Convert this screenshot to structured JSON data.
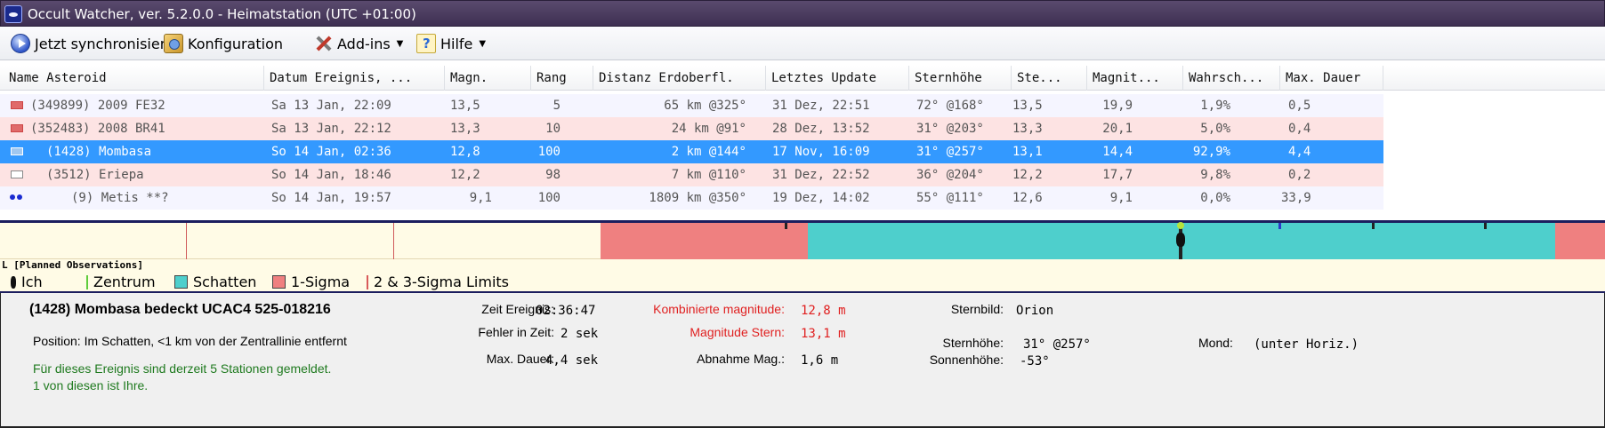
{
  "window": {
    "title": "Occult Watcher, ver. 5.2.0.0 - Heimatstation (UTC +01:00)"
  },
  "toolbar": {
    "sync": "Jetzt synchronisieren",
    "config": "Konfiguration",
    "addins": "Add-ins",
    "help": "Hilfe"
  },
  "table": {
    "headers": [
      "Name Asteroid",
      "Datum Ereignis, ...",
      "Magn.",
      "Rang",
      "Distanz Erdoberfl.",
      "Letztes Update",
      "Sternhöhe",
      "Ste...",
      "Magnit...",
      "Wahrsch...",
      "Max. Dauer"
    ],
    "rows": [
      {
        "name": "(349899) 2009 FE32",
        "date": "Sa 13 Jan, 22:09",
        "magn": "13,5",
        "rang": "5",
        "dist": "65 km @325°",
        "update": "31 Dez, 22:51",
        "alt": "72° @168°",
        "ste": "13,5",
        "magnit": "19,9",
        "prob": "1,9%",
        "dur": "0,5"
      },
      {
        "name": "(352483) 2008 BR41",
        "date": "Sa 13 Jan, 22:12",
        "magn": "13,3",
        "rang": "10",
        "dist": "24 km @91°",
        "update": "28 Dez, 13:52",
        "alt": "31° @203°",
        "ste": "13,3",
        "magnit": "20,1",
        "prob": "5,0%",
        "dur": "0,4"
      },
      {
        "name": "(1428) Mombasa",
        "date": "So 14 Jan, 02:36",
        "magn": "12,8",
        "rang": "100",
        "dist": "2 km @144°",
        "update": "17 Nov, 16:09",
        "alt": "31° @257°",
        "ste": "13,1",
        "magnit": "14,4",
        "prob": "92,9%",
        "dur": "4,4"
      },
      {
        "name": "(3512) Eriepa",
        "date": "So 14 Jan, 18:46",
        "magn": "12,2",
        "rang": "98",
        "dist": "7 km @110°",
        "update": "31 Dez, 22:52",
        "alt": "36° @204°",
        "ste": "12,2",
        "magnit": "17,7",
        "prob": "9,8%",
        "dur": "0,2"
      },
      {
        "name": "(9) Metis **?",
        "date": "So 14 Jan, 19:57",
        "magn": "9,1",
        "rang": "100",
        "dist": "1809 km @350°",
        "update": "19 Dez, 14:02",
        "alt": "55° @111°",
        "ste": "12,6",
        "magnit": "9,1",
        "prob": "0,0%",
        "dur": "33,9"
      }
    ]
  },
  "planned_label": "L [Planned Observations]",
  "legend": {
    "ich": "Ich",
    "zentrum": "Zentrum",
    "schatten": "Schatten",
    "sigma1": "1-Sigma",
    "limits": "2 & 3-Sigma Limits"
  },
  "details": {
    "title": "(1428) Mombasa bedeckt UCAC4 525-018216",
    "position": "Position:  Im Schatten, <1 km von der Zentrallinie entfernt",
    "stations_line1": "Für dieses Ereignis sind derzeit 5 Stationen gemeldet.",
    "stations_line2": "1 von diesen ist Ihre.",
    "zeit_label": "Zeit Ereignis:",
    "zeit_value": "02:36:47",
    "fehler_label": "Fehler in Zeit:",
    "fehler_value": "2 sek",
    "dauer_label": "Max. Dauer:",
    "dauer_value": "4,4 sek",
    "kombi_label": "Kombinierte magnitude:",
    "kombi_value": "12,8 m",
    "magstern_label": "Magnitude Stern:",
    "magstern_value": "13,1 m",
    "abnahme_label": "Abnahme Mag.:",
    "abnahme_value": "1,6 m",
    "sternbild_label": "Sternbild:",
    "sternbild_value": "Orion",
    "sternhoehe_label": "Sternhöhe:",
    "sternhoehe_value": "31° @257°",
    "sonnenhoehe_label": "Sonnenhöhe:",
    "sonnenhoehe_value": "-53°",
    "mond_label": "Mond:",
    "mond_value": "(unter Horiz.)"
  },
  "colors": {
    "selected_row": "#3399ff",
    "shadow": "#4ecfcc",
    "sigma1": "#ef8080",
    "row_pink": "#fde3e3",
    "row_light": "#f5f5ff"
  }
}
